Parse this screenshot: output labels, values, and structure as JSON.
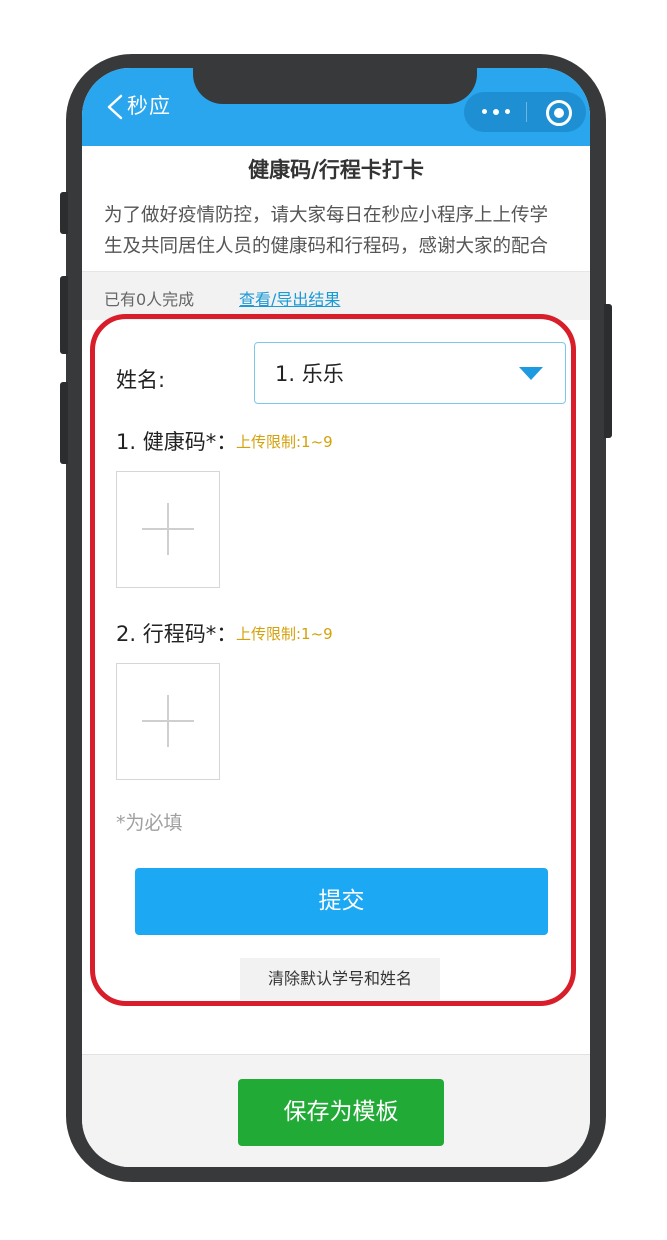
{
  "navbar": {
    "title": "秒应"
  },
  "header": {
    "title": "健康码/行程卡打卡",
    "description_line1": "为了做好疫情防控，请大家每日在秒应小程序上上传学",
    "description_line2": "生及共同居住人员的健康码和行程码，感谢大家的配合"
  },
  "stats": {
    "completed_text": "已有0人完成",
    "view_export_link": "查看/导出结果"
  },
  "form": {
    "name_label": "姓名:",
    "name_selected": "1. 乐乐",
    "fields": [
      {
        "label": "1. 健康码*：",
        "limit": "上传限制:1~9"
      },
      {
        "label": "2. 行程码*：",
        "limit": "上传限制:1~9"
      }
    ],
    "required_note": "*为必填",
    "submit_label": "提交",
    "clear_label": "清除默认学号和姓名"
  },
  "footer": {
    "save_template_label": "保存为模板"
  },
  "colors": {
    "navbar": "#2aa6ee",
    "submit": "#1da8f3",
    "save": "#22aa37",
    "highlight": "#d81e2a",
    "limit_text": "#d4a10a"
  }
}
